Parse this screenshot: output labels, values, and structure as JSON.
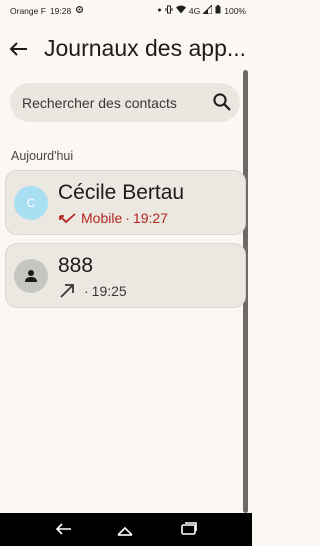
{
  "status": {
    "carrier": "Orange F",
    "time": "19:28",
    "network": "4G",
    "battery": "100%"
  },
  "header": {
    "title": "Journaux des app..."
  },
  "search": {
    "placeholder": "Rechercher des contacts"
  },
  "section_title": "Aujourd'hui",
  "entries": [
    {
      "avatar_letter": "C",
      "name": "Cécile Bertau",
      "call_type": "missed",
      "type_label": "Mobile",
      "time": "19:27"
    },
    {
      "avatar_icon": "person-icon",
      "name": "888",
      "call_type": "outgoing",
      "type_label": "",
      "time": "19:25"
    }
  ],
  "detail_separator": " · ",
  "colors": {
    "background": "#fbf7f3",
    "missed": "#b3261e",
    "avatar": "#a8dff3"
  }
}
